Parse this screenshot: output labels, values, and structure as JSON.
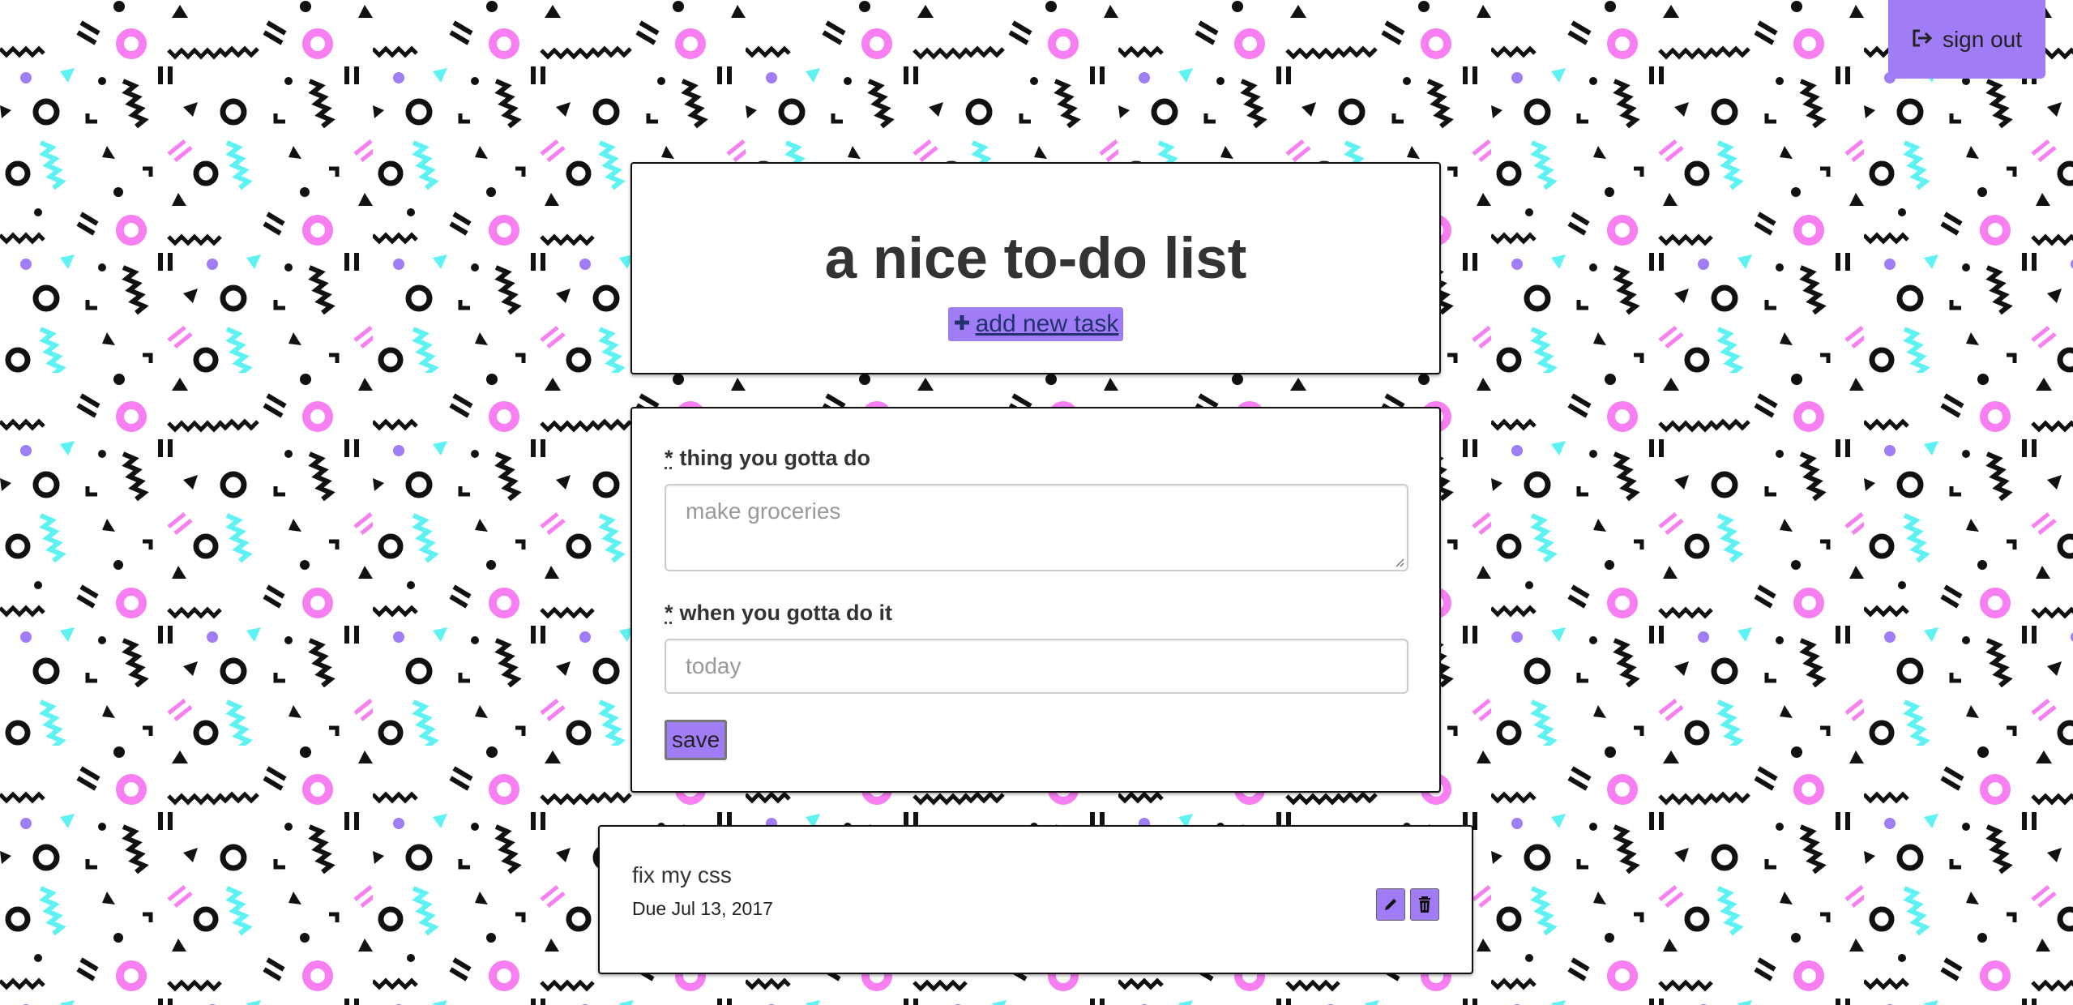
{
  "header": {
    "sign_out_label": "sign out",
    "title": "a nice to-do list",
    "add_task_label": " add new task"
  },
  "form": {
    "required_marker": "*",
    "task_label": "thing you gotta do",
    "task_placeholder": "make groceries",
    "date_label": "when you gotta do it",
    "date_placeholder": "today",
    "save_label": "save"
  },
  "tasks": [
    {
      "name": "fix my css",
      "due": "Due Jul 13, 2017"
    }
  ],
  "icons": {
    "sign_out": "sign-out-icon",
    "add": "plus-icon",
    "edit": "pencil-icon",
    "delete": "trash-icon"
  },
  "colors": {
    "accent": "#a07cf6",
    "link": "#23326f",
    "pattern_pink": "#f77ff2",
    "pattern_cyan": "#5ef2f2",
    "pattern_purple": "#a07cf6",
    "pattern_black": "#111111"
  }
}
